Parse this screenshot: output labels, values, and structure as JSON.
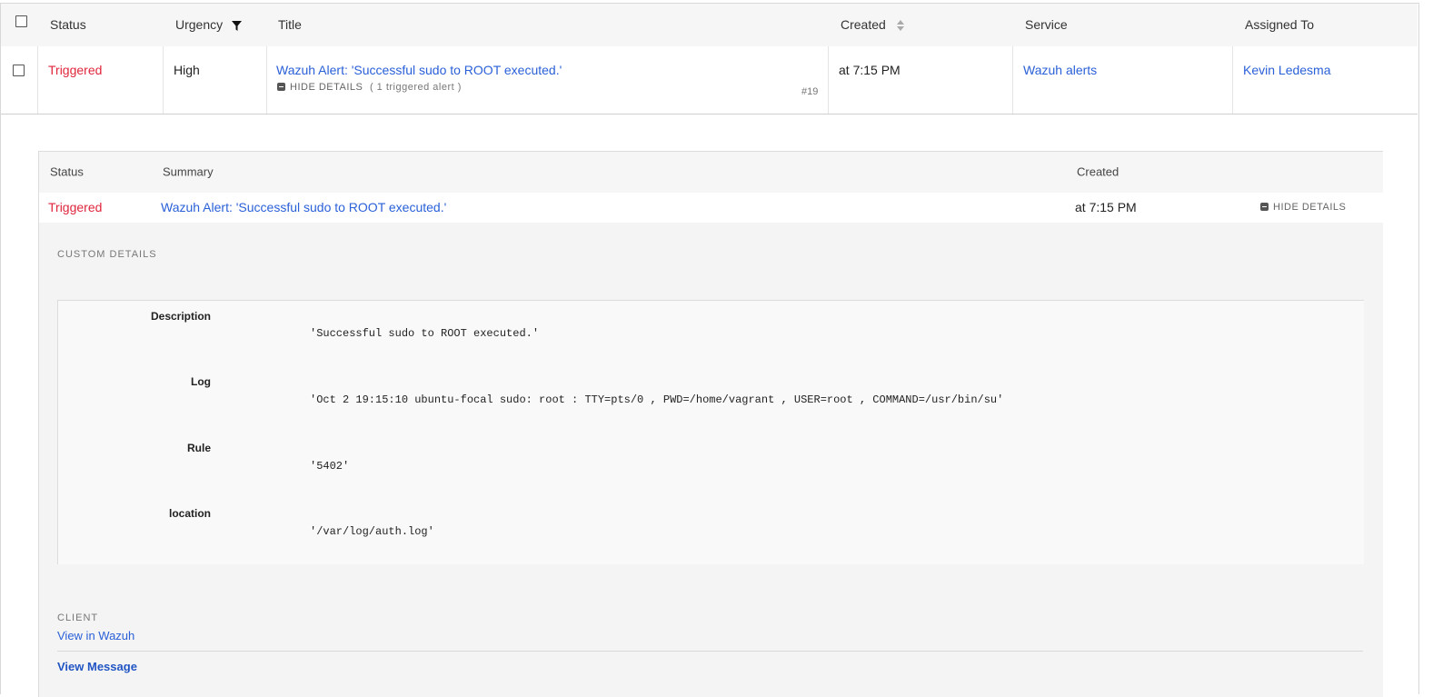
{
  "incidents_table": {
    "headers": {
      "status": "Status",
      "urgency": "Urgency",
      "title": "Title",
      "created": "Created",
      "service": "Service",
      "assigned_to": "Assigned To"
    },
    "row": {
      "status": "Triggered",
      "urgency": "High",
      "title": "Wazuh Alert: 'Successful sudo to ROOT executed.'",
      "hide_details": "HIDE DETAILS",
      "alerts_count": "( 1 triggered alert )",
      "number": "#19",
      "created": "at 7:15 PM",
      "service": "Wazuh alerts",
      "assigned_to": "Kevin Ledesma"
    }
  },
  "alerts_table": {
    "headers": {
      "status": "Status",
      "summary": "Summary",
      "created": "Created"
    },
    "row": {
      "status": "Triggered",
      "summary": "Wazuh Alert: 'Successful sudo to ROOT executed.'",
      "created": "at 7:15 PM",
      "hide_details": "HIDE DETAILS"
    }
  },
  "custom_details": {
    "label": "CUSTOM DETAILS",
    "fields": [
      {
        "key": "Description",
        "value": "'Successful sudo to ROOT executed.'"
      },
      {
        "key": "Log",
        "value": "'Oct 2 19:15:10 ubuntu-focal sudo: root : TTY=pts/0 , PWD=/home/vagrant , USER=root , COMMAND=/usr/bin/su'"
      },
      {
        "key": "Rule",
        "value": "'5402'"
      },
      {
        "key": "location",
        "value": "'/var/log/auth.log'"
      }
    ]
  },
  "client": {
    "label": "CLIENT",
    "link": "View in Wazuh",
    "view_message": "View Message"
  },
  "colors": {
    "triggered": "#e0263c",
    "link": "#2a60d8"
  }
}
